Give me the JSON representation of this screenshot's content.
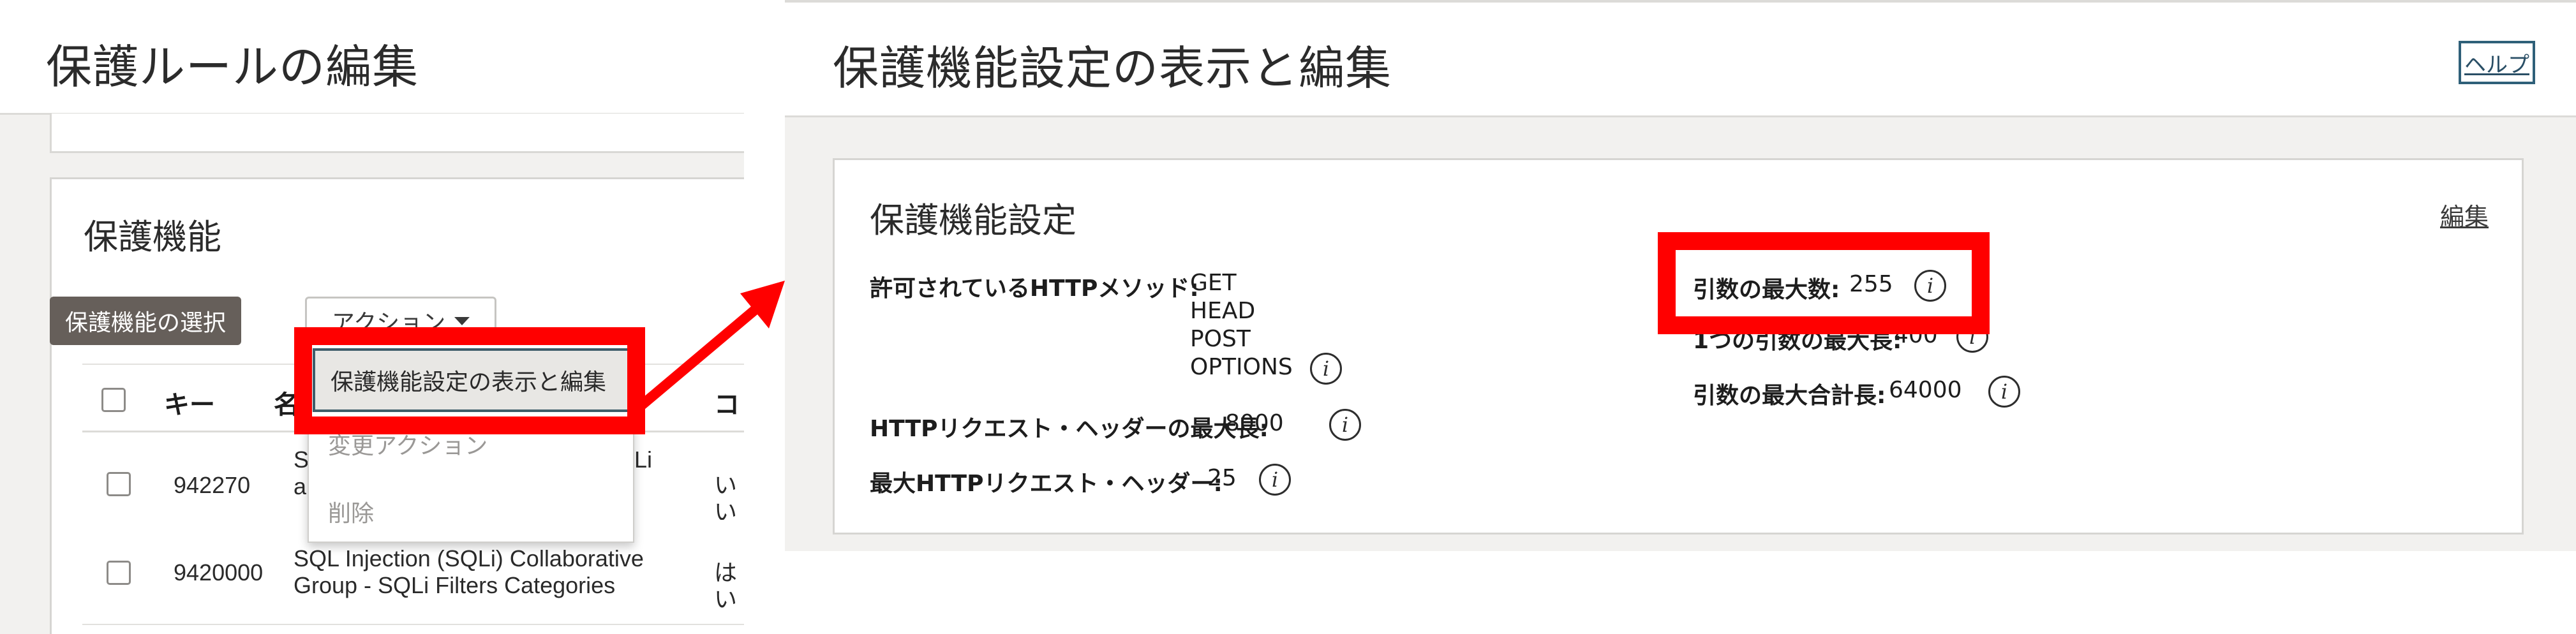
{
  "left": {
    "page_title": "保護ルールの編集",
    "section_title": "保護機能",
    "select_button": "保護機能の選択",
    "action_button": "アクション",
    "table": {
      "headers": [
        "キー",
        "名",
        "コ"
      ],
      "rows": [
        {
          "key": "942270",
          "name_line1": "S",
          "name_line1_tail": "Li",
          "name_line2": "a",
          "col3": "いい"
        },
        {
          "key": "9420000",
          "name_line1": "SQL Injection (SQLi) Collaborative",
          "name_line2": "Group - SQLi Filters Categories",
          "col3": "はい"
        }
      ]
    },
    "menu": {
      "items": [
        "保護機能設定の表示と編集",
        "変更アクション",
        "削除"
      ]
    }
  },
  "right": {
    "page_title": "保護機能設定の表示と編集",
    "help_link": "ヘルプ",
    "card_title": "保護機能設定",
    "edit_link": "編集",
    "allowed_methods_label": "許可されているHTTPメソッド:",
    "allowed_methods": [
      "GET",
      "HEAD",
      "POST",
      "OPTIONS"
    ],
    "max_header_length_label": "HTTPリクエスト・ヘッダーの最大長:",
    "max_header_length_value": "8000",
    "max_headers_label": "最大HTTPリクエスト・ヘッダー:",
    "max_headers_value": "25",
    "max_args_label": "引数の最大数:",
    "max_args_value": "255",
    "single_arg_label_partial": "1つの引数の最大長:",
    "single_arg_value_partial": "400",
    "max_total_args_label": "引数の最大合計長:",
    "max_total_args_value": "64000",
    "info_glyph": "i"
  },
  "colors": {
    "highlight": "#ff0000",
    "select_button_bg": "#665f5a",
    "focus_border": "#3e5d6a",
    "link": "#2a4f66",
    "page_bg": "#f2f1ef"
  },
  "icons": [
    "caret-down-icon",
    "info-icon",
    "arrow-right-icon",
    "checkbox-icon"
  ]
}
